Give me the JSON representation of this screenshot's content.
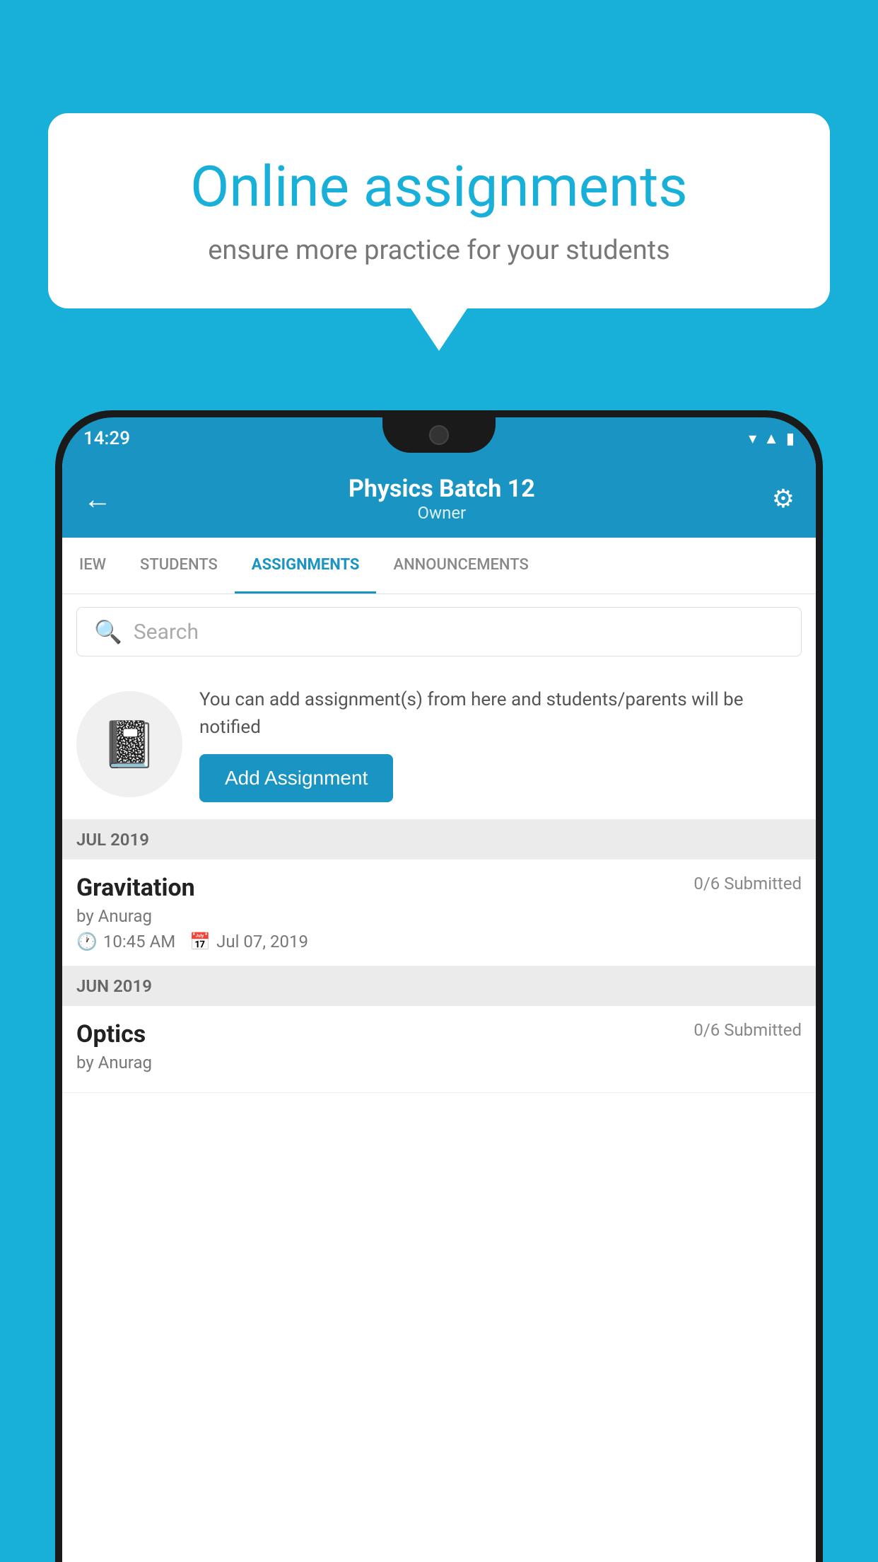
{
  "background_color": "#18b0d8",
  "speech_bubble": {
    "title": "Online assignments",
    "subtitle": "ensure more practice for your students"
  },
  "status_bar": {
    "time": "14:29",
    "icons": [
      "wifi",
      "signal",
      "battery"
    ]
  },
  "app_header": {
    "title": "Physics Batch 12",
    "subtitle": "Owner",
    "back_label": "←",
    "settings_label": "⚙"
  },
  "tabs": [
    {
      "label": "IEW",
      "active": false
    },
    {
      "label": "STUDENTS",
      "active": false
    },
    {
      "label": "ASSIGNMENTS",
      "active": true
    },
    {
      "label": "ANNOUNCEMENTS",
      "active": false
    }
  ],
  "search": {
    "placeholder": "Search"
  },
  "empty_state": {
    "description": "You can add assignment(s) from here and students/parents will be notified",
    "add_button_label": "Add Assignment"
  },
  "sections": [
    {
      "label": "JUL 2019",
      "assignments": [
        {
          "name": "Gravitation",
          "submitted": "0/6 Submitted",
          "by": "by Anurag",
          "time": "10:45 AM",
          "date": "Jul 07, 2019"
        }
      ]
    },
    {
      "label": "JUN 2019",
      "assignments": [
        {
          "name": "Optics",
          "submitted": "0/6 Submitted",
          "by": "by Anurag",
          "time": "",
          "date": ""
        }
      ]
    }
  ]
}
